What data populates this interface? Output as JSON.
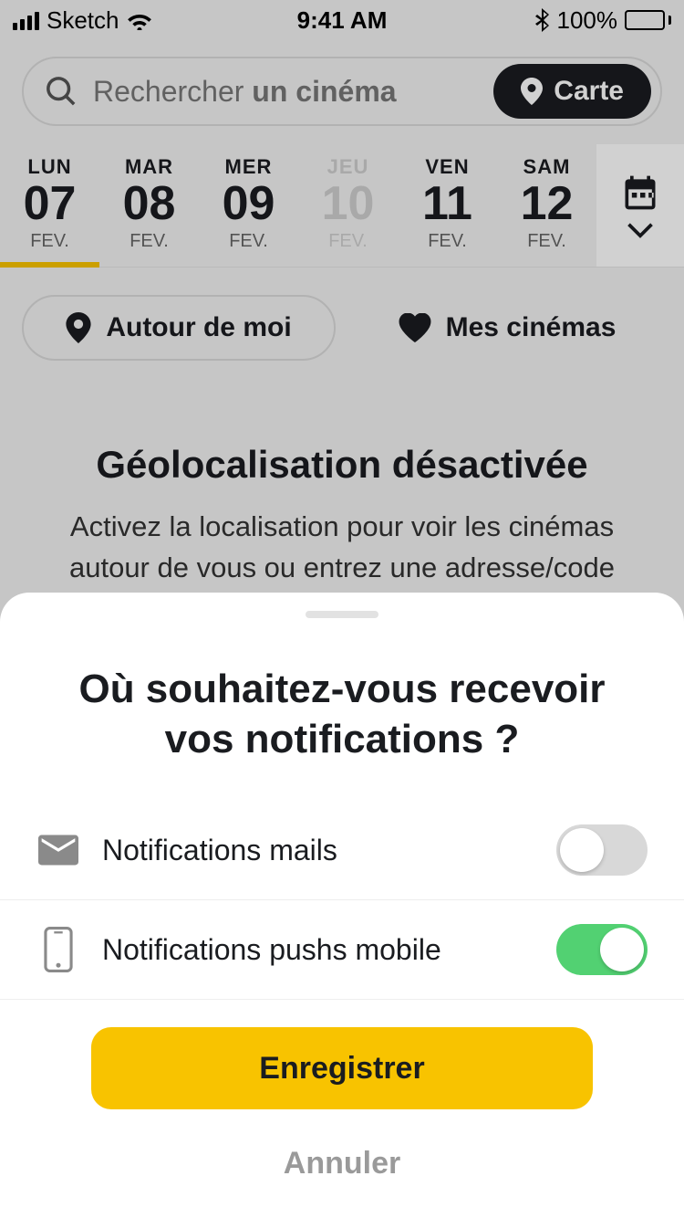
{
  "status": {
    "carrier": "Sketch",
    "time": "9:41 AM",
    "battery": "100%"
  },
  "search": {
    "prefix": "Rechercher ",
    "bold": "un cinéma",
    "map_label": "Carte"
  },
  "dates": [
    {
      "day": "LUN",
      "num": "07",
      "mon": "FEV."
    },
    {
      "day": "MAR",
      "num": "08",
      "mon": "FEV."
    },
    {
      "day": "MER",
      "num": "09",
      "mon": "FEV."
    },
    {
      "day": "JEU",
      "num": "10",
      "mon": "FEV."
    },
    {
      "day": "VEN",
      "num": "11",
      "mon": "FEV."
    },
    {
      "day": "SAM",
      "num": "12",
      "mon": "FEV."
    }
  ],
  "chips": {
    "around": "Autour de moi",
    "mine": "Mes cinémas"
  },
  "geo": {
    "title": "Géolocalisation désactivée",
    "body": "Activez la localisation pour voir les cinémas autour de vous ou entrez une adresse/code postal dans la"
  },
  "sheet": {
    "title": "Où souhaitez-vous recevoir vos notifications ?",
    "opt_mail": "Notifications mails",
    "opt_push": "Notifications pushs mobile",
    "save": "Enregistrer",
    "cancel": "Annuler"
  }
}
